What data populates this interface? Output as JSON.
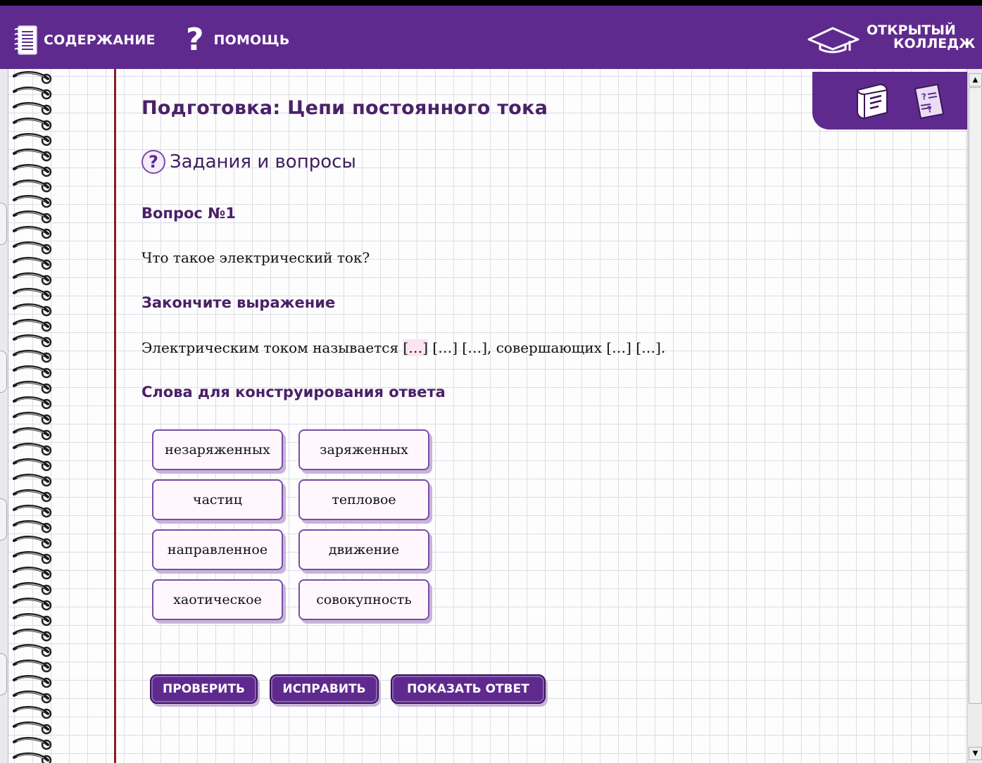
{
  "topbar": {
    "contents_label": "СОДЕРЖАНИЕ",
    "help_label": "ПОМОЩЬ",
    "brand_line1": "ОТКРЫТЫЙ",
    "brand_line2": "КОЛЛЕДЖ"
  },
  "colors": {
    "brand_purple": "#5f2a8e",
    "title_purple": "#4a2168",
    "margin_red": "#8c1d1d",
    "grid_line": "#dcdde6",
    "blank_highlight": "#fbe3f1"
  },
  "page": {
    "title": "Подготовка: Цепи постоянного тока",
    "section_label": "Задания и вопросы",
    "question_heading": "Вопрос №1",
    "question_text": "Что такое электрический ток?",
    "instruction": "Закончите выражение",
    "sentence": {
      "prefix": "Электрическим током называется ",
      "blanks": [
        "[…]",
        "[…]",
        "[…]",
        "[…]",
        "[…]"
      ],
      "connector": ", совершающих ",
      "suffix": "."
    },
    "words_heading": "Слова для конструирования ответа",
    "words": [
      "незаряженных",
      "заряженных",
      "частиц",
      "тепловое",
      "направленное",
      "движение",
      "хаотическое",
      "совокупность"
    ],
    "buttons": {
      "check": "ПРОВЕРИТЬ",
      "fix": "ИСПРАВИТЬ",
      "show": "ПОКАЗАТЬ ОТВЕТ"
    }
  },
  "icons": {
    "contents": "notebook-icon",
    "help": "question-mark-icon",
    "brand": "graduation-cap-icon",
    "tab_book": "book-icon",
    "tab_quiz": "quiz-sheet-icon",
    "section": "question-circle-icon"
  }
}
